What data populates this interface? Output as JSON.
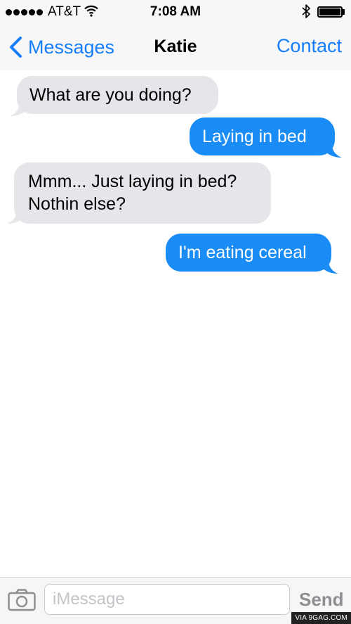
{
  "status_bar": {
    "carrier": "AT&T",
    "time": "7:08 AM",
    "signal_bars": 5,
    "battery_level_percent": 100,
    "icons": [
      "signal-dots-icon",
      "wifi-icon",
      "bluetooth-icon",
      "battery-icon"
    ]
  },
  "nav": {
    "back_label": "Messages",
    "title": "Katie",
    "contact_label": "Contact"
  },
  "messages": [
    {
      "direction": "incoming",
      "text": "What are you doing?"
    },
    {
      "direction": "outgoing",
      "text": "Laying in bed"
    },
    {
      "direction": "incoming",
      "text": "Mmm... Just laying in bed?\nNothin else?"
    },
    {
      "direction": "outgoing",
      "text": "I'm eating cereal"
    }
  ],
  "composer": {
    "placeholder": "iMessage",
    "value": "",
    "send_label": "Send"
  },
  "watermark": "VIA 9GAG.COM",
  "colors": {
    "accent": "#157efb",
    "outgoing_bubble": "#1a8cf5",
    "incoming_bubble": "#e5e5ea",
    "send_disabled": "#8e8e93"
  }
}
